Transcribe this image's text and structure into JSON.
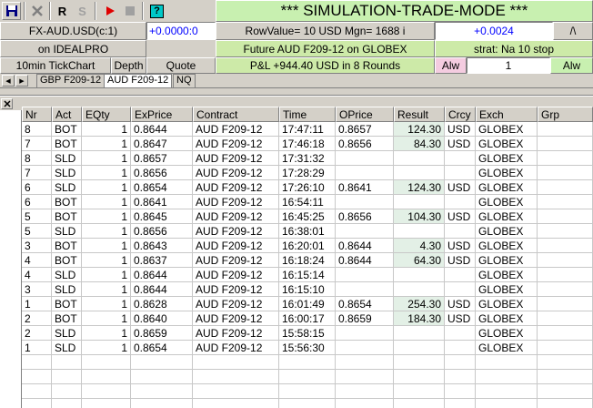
{
  "toolbar": {
    "r_label": "R",
    "s_label": "S",
    "help_label": "?",
    "mode_banner": "*** SIMULATION-TRADE-MODE ***"
  },
  "header": {
    "symbol": "FX-AUD.USD(c:1)",
    "exchange": "on IDEALPRO",
    "chart_type": "10min TickChart",
    "depth_label": "Depth",
    "quote_label": "Quote",
    "price_left": "+0.0000:0",
    "row_value": "RowValue= 10 USD Mgn= 1688 i",
    "future": "Future AUD  F209-12 on GLOBEX",
    "pnl": "P&L +944.40 USD in 8 Rounds",
    "price_right": "+0.0024",
    "caret": "/\\",
    "strat": "strat: Na 10 stop",
    "alw_left": "Alw",
    "qty": "1",
    "alw_right": "Alw"
  },
  "tabs": [
    {
      "label": "GBP F209-12"
    },
    {
      "label": "AUD F209-12"
    },
    {
      "label": "NQ"
    }
  ],
  "colors": {
    "banner": "#c8f0b0",
    "pnl_bg": "#cdeaa8",
    "result_highlight": "#e3f0e6",
    "price_blue": "#0000ff",
    "alw_pink": "#f4cce0",
    "alw_green": "#c8f0b0"
  },
  "table": {
    "columns": [
      "Nr",
      "Act",
      "EQty",
      "ExPrice",
      "Contract",
      "Time",
      "OPrice",
      "Result",
      "Crcy",
      "Exch",
      "Grp"
    ],
    "rows": [
      {
        "nr": "8",
        "act": "BOT",
        "qty": "1",
        "price": "0.8644",
        "contract": "AUD  F209-12",
        "time": "17:47:11",
        "oprice": "0.8657",
        "result": "124.30",
        "crcy": "USD",
        "exch": "GLOBEX"
      },
      {
        "nr": "7",
        "act": "BOT",
        "qty": "1",
        "price": "0.8647",
        "contract": "AUD  F209-12",
        "time": "17:46:18",
        "oprice": "0.8656",
        "result": "84.30",
        "crcy": "USD",
        "exch": "GLOBEX"
      },
      {
        "nr": "8",
        "act": "SLD",
        "qty": "1",
        "price": "0.8657",
        "contract": "AUD  F209-12",
        "time": "17:31:32",
        "oprice": "",
        "result": "",
        "crcy": "",
        "exch": "GLOBEX"
      },
      {
        "nr": "7",
        "act": "SLD",
        "qty": "1",
        "price": "0.8656",
        "contract": "AUD  F209-12",
        "time": "17:28:29",
        "oprice": "",
        "result": "",
        "crcy": "",
        "exch": "GLOBEX"
      },
      {
        "nr": "6",
        "act": "SLD",
        "qty": "1",
        "price": "0.8654",
        "contract": "AUD  F209-12",
        "time": "17:26:10",
        "oprice": "0.8641",
        "result": "124.30",
        "crcy": "USD",
        "exch": "GLOBEX"
      },
      {
        "nr": "6",
        "act": "BOT",
        "qty": "1",
        "price": "0.8641",
        "contract": "AUD  F209-12",
        "time": "16:54:11",
        "oprice": "",
        "result": "",
        "crcy": "",
        "exch": "GLOBEX"
      },
      {
        "nr": "5",
        "act": "BOT",
        "qty": "1",
        "price": "0.8645",
        "contract": "AUD  F209-12",
        "time": "16:45:25",
        "oprice": "0.8656",
        "result": "104.30",
        "crcy": "USD",
        "exch": "GLOBEX"
      },
      {
        "nr": "5",
        "act": "SLD",
        "qty": "1",
        "price": "0.8656",
        "contract": "AUD  F209-12",
        "time": "16:38:01",
        "oprice": "",
        "result": "",
        "crcy": "",
        "exch": "GLOBEX"
      },
      {
        "nr": "3",
        "act": "BOT",
        "qty": "1",
        "price": "0.8643",
        "contract": "AUD  F209-12",
        "time": "16:20:01",
        "oprice": "0.8644",
        "result": "4.30",
        "crcy": "USD",
        "exch": "GLOBEX"
      },
      {
        "nr": "4",
        "act": "BOT",
        "qty": "1",
        "price": "0.8637",
        "contract": "AUD  F209-12",
        "time": "16:18:24",
        "oprice": "0.8644",
        "result": "64.30",
        "crcy": "USD",
        "exch": "GLOBEX"
      },
      {
        "nr": "4",
        "act": "SLD",
        "qty": "1",
        "price": "0.8644",
        "contract": "AUD  F209-12",
        "time": "16:15:14",
        "oprice": "",
        "result": "",
        "crcy": "",
        "exch": "GLOBEX"
      },
      {
        "nr": "3",
        "act": "SLD",
        "qty": "1",
        "price": "0.8644",
        "contract": "AUD  F209-12",
        "time": "16:15:10",
        "oprice": "",
        "result": "",
        "crcy": "",
        "exch": "GLOBEX"
      },
      {
        "nr": "1",
        "act": "BOT",
        "qty": "1",
        "price": "0.8628",
        "contract": "AUD  F209-12",
        "time": "16:01:49",
        "oprice": "0.8654",
        "result": "254.30",
        "crcy": "USD",
        "exch": "GLOBEX"
      },
      {
        "nr": "2",
        "act": "BOT",
        "qty": "1",
        "price": "0.8640",
        "contract": "AUD  F209-12",
        "time": "16:00:17",
        "oprice": "0.8659",
        "result": "184.30",
        "crcy": "USD",
        "exch": "GLOBEX"
      },
      {
        "nr": "2",
        "act": "SLD",
        "qty": "1",
        "price": "0.8659",
        "contract": "AUD  F209-12",
        "time": "15:58:15",
        "oprice": "",
        "result": "",
        "crcy": "",
        "exch": "GLOBEX"
      },
      {
        "nr": "1",
        "act": "SLD",
        "qty": "1",
        "price": "0.8654",
        "contract": "AUD  F209-12",
        "time": "15:56:30",
        "oprice": "",
        "result": "",
        "crcy": "",
        "exch": "GLOBEX"
      }
    ]
  }
}
